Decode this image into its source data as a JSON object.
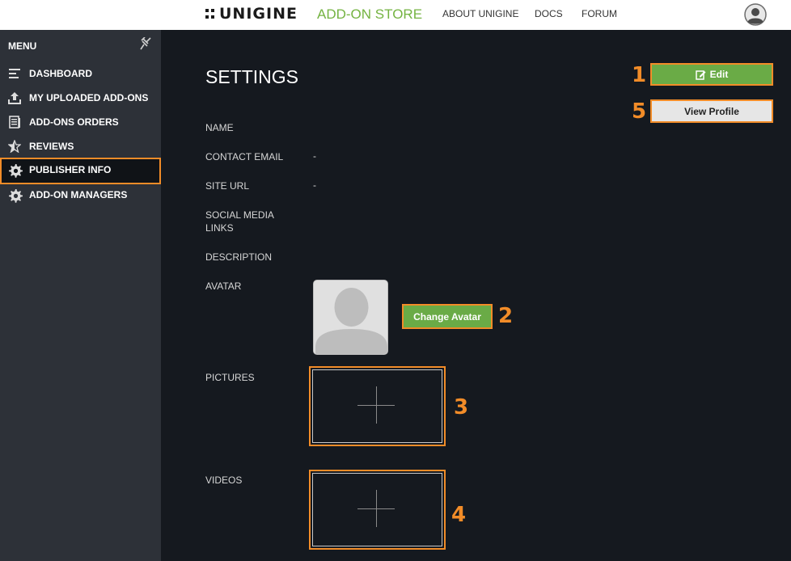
{
  "header": {
    "logo_text": "UNIGINE",
    "store_text": "ADD-ON STORE",
    "nav": [
      "ABOUT UNIGINE",
      "DOCS",
      "FORUM"
    ]
  },
  "sidebar": {
    "title": "MENU",
    "items": [
      {
        "label": "DASHBOARD",
        "icon": "dashboard-icon"
      },
      {
        "label": "MY UPLOADED ADD-ONS",
        "icon": "upload-icon"
      },
      {
        "label": "ADD-ONS ORDERS",
        "icon": "orders-icon"
      },
      {
        "label": "REVIEWS",
        "icon": "star-icon"
      },
      {
        "label": "PUBLISHER INFO",
        "icon": "gear-icon",
        "active": true
      },
      {
        "label": "ADD-ON MANAGERS",
        "icon": "gear-icon"
      }
    ]
  },
  "main": {
    "title": "SETTINGS",
    "fields": {
      "name": {
        "label": "NAME",
        "value": ""
      },
      "contact_email": {
        "label": "CONTACT EMAIL",
        "value": "-"
      },
      "site_url": {
        "label": "SITE URL",
        "value": "-"
      },
      "social_media": {
        "label": "SOCIAL MEDIA LINKS",
        "value": ""
      },
      "description": {
        "label": "DESCRIPTION",
        "value": ""
      },
      "avatar": {
        "label": "AVATAR"
      },
      "pictures": {
        "label": "PICTURES"
      },
      "videos": {
        "label": "VIDEOS"
      }
    },
    "buttons": {
      "edit": "Edit",
      "view_profile": "View Profile",
      "change_avatar": "Change Avatar"
    }
  },
  "callouts": [
    "1",
    "2",
    "3",
    "4",
    "5"
  ],
  "colors": {
    "accent_green": "#74b341",
    "highlight": "#f28c28",
    "sidebar_bg": "#2d3138",
    "main_bg": "#15191f"
  }
}
